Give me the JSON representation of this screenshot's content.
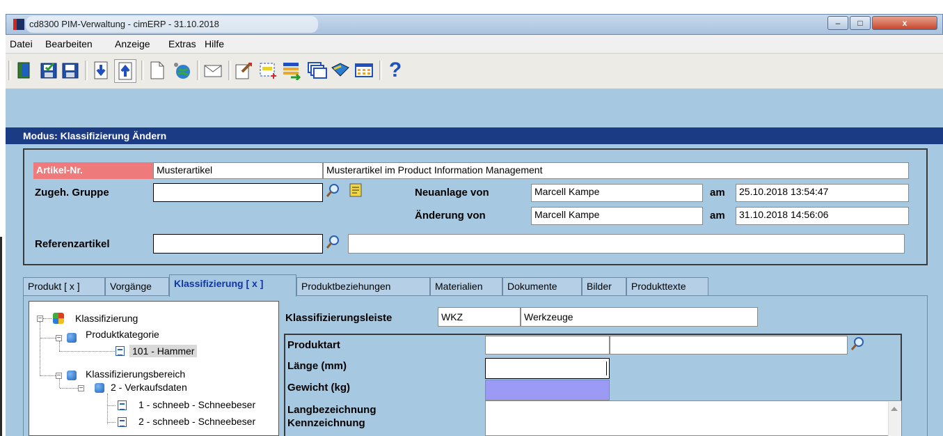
{
  "window": {
    "title": "cd8300 PIM-Verwaltung - cimERP - 31.10.2018",
    "minimize": "–",
    "maximize": "□",
    "close": "x"
  },
  "menu": [
    "Datei",
    "Bearbeiten",
    "Anzeige",
    "Extras",
    "Hilfe"
  ],
  "toolbar_icons": [
    "exit-icon",
    "save-check-icon",
    "save-icon",
    "arrow-down-icon",
    "arrow-up-icon",
    "new-document-icon",
    "globe-icon",
    "mail-icon",
    "edit-icon",
    "select-add-icon",
    "list-transfer-icon",
    "windows-icon",
    "book-icon",
    "grid-icon",
    "help-icon"
  ],
  "help_glyph": "?",
  "modus": "Modus: Klassifizierung Ändern",
  "header": {
    "artnr_label": "Artikel-Nr.",
    "artnr_value": "Musterartikel",
    "artnr_desc": "Musterartikel im Product Information Management",
    "gruppe_label": "Zugeh. Gruppe",
    "gruppe_value": "",
    "neuanlage_label": "Neuanlage von",
    "neuanlage_user": "Marcell Kampe",
    "neuanlage_am": "am",
    "neuanlage_date": "25.10.2018 13:54:47",
    "aenderung_label": "Änderung von",
    "aenderung_user": "Marcell Kampe",
    "aenderung_am": "am",
    "aenderung_date": "31.10.2018 14:56:06",
    "referenz_label": "Referenzartikel",
    "referenz_value": "",
    "referenz_desc": ""
  },
  "tabs": [
    {
      "label": "Produkt [ x ]"
    },
    {
      "label": "Vorgänge"
    },
    {
      "label": "Klassifizierung [ x ]"
    },
    {
      "label": "Produktbeziehungen"
    },
    {
      "label": "Materialien"
    },
    {
      "label": "Dokumente"
    },
    {
      "label": "Bilder"
    },
    {
      "label": "Produkttexte"
    }
  ],
  "tree": {
    "root": "Klassifizierung",
    "produktkategorie": "Produktkategorie",
    "hammer": "101 - Hammer",
    "bereich": "Klassifizierungsbereich",
    "verkaufsdaten": "2 - Verkaufsdaten",
    "schneeb1": "1 - schneeb - Schneebeser",
    "schneeb2": "2 - schneeb - Schneebeser"
  },
  "leiste": {
    "label": "Klassifizierungsleiste",
    "code": "WKZ",
    "name": "Werkzeuge"
  },
  "attributes": {
    "produktart": "Produktart",
    "laenge": "Länge (mm)",
    "gewicht": "Gewicht (kg)",
    "langbezeichnung": "Langbezeichnung",
    "kennzeichnung": "Kennzeichnung",
    "produktart_value": "",
    "produktart_desc": "",
    "laenge_value": "",
    "gewicht_value": "",
    "langbezeichnung_value": ""
  },
  "colors": {
    "body_bg": "#a6c8e1",
    "modus_bg": "#1c3b85",
    "artnr_label_bg": "#ef7a7c",
    "gewicht_field_bg": "#9b9bf5",
    "active_tab_text": "#1235a8"
  }
}
